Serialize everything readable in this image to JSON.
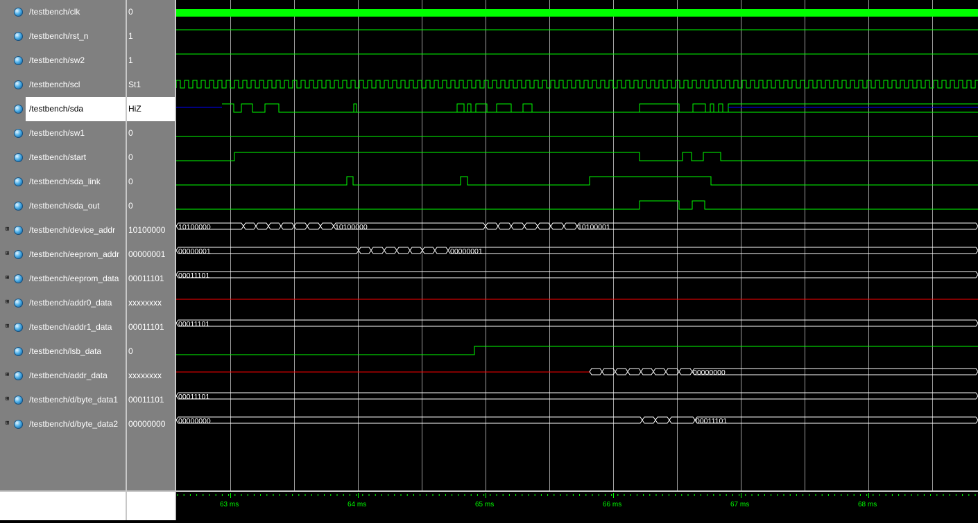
{
  "colors": {
    "wave": "#00ff00",
    "highz": "#0000ff",
    "unknown": "#ff0000",
    "bus": "#ffffff",
    "grid": "#a0a0a0",
    "axis_text": "#00ff00"
  },
  "signals": [
    {
      "name": "/testbench/clk",
      "value": "0",
      "bus": false
    },
    {
      "name": "/testbench/rst_n",
      "value": "1",
      "bus": false
    },
    {
      "name": "/testbench/sw2",
      "value": "1",
      "bus": false
    },
    {
      "name": "/testbench/scl",
      "value": "St1",
      "bus": false
    },
    {
      "name": "/testbench/sda",
      "value": "HiZ",
      "bus": false,
      "selected": true
    },
    {
      "name": "/testbench/sw1",
      "value": "0",
      "bus": false
    },
    {
      "name": "/testbench/start",
      "value": "0",
      "bus": false
    },
    {
      "name": "/testbench/sda_link",
      "value": "0",
      "bus": false
    },
    {
      "name": "/testbench/sda_out",
      "value": "0",
      "bus": false
    },
    {
      "name": "/testbench/device_addr",
      "value": "10100000",
      "bus": true
    },
    {
      "name": "/testbench/eeprom_addr",
      "value": "00000001",
      "bus": true
    },
    {
      "name": "/testbench/eeprom_data",
      "value": "00011101",
      "bus": true
    },
    {
      "name": "/testbench/addr0_data",
      "value": "xxxxxxxx",
      "bus": true
    },
    {
      "name": "/testbench/addr1_data",
      "value": "00011101",
      "bus": true
    },
    {
      "name": "/testbench/lsb_data",
      "value": "0",
      "bus": false
    },
    {
      "name": "/testbench/addr_data",
      "value": "xxxxxxxx",
      "bus": true
    },
    {
      "name": "/testbench/d/byte_data1",
      "value": "00011101",
      "bus": true
    },
    {
      "name": "/testbench/d/byte_data2",
      "value": "00000000",
      "bus": true
    }
  ],
  "bus_labels": {
    "device_addr": [
      "10100000",
      "10100000",
      "10100001"
    ],
    "eeprom_addr": [
      "00000001",
      "00000001"
    ],
    "eeprom_data": [
      "00011101"
    ],
    "addr1_data": [
      "00011101"
    ],
    "addr_data": [
      "00000000"
    ],
    "byte_data1": [
      "00011101"
    ],
    "byte_data2": [
      "00000000",
      "00011101"
    ]
  },
  "time_axis": {
    "unit": "ms",
    "ticks": [
      "63 ms",
      "64 ms",
      "65 ms",
      "66 ms",
      "67 ms",
      "68 ms"
    ]
  }
}
